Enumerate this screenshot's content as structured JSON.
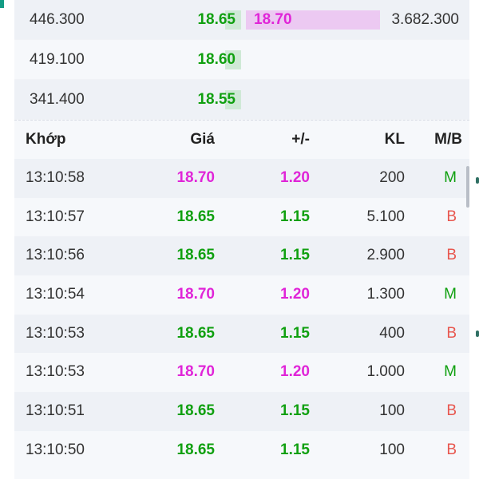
{
  "depth": [
    {
      "volume": "446.300",
      "bid_price": "18.65",
      "ask_price": "18.70",
      "ask_volume": "3.682.300"
    },
    {
      "volume": "419.100",
      "bid_price": "18.60",
      "ask_price": "",
      "ask_volume": ""
    },
    {
      "volume": "341.400",
      "bid_price": "18.55",
      "ask_price": "",
      "ask_volume": ""
    }
  ],
  "trades_header": {
    "time": "Khớp",
    "price": "Giá",
    "change": "+/-",
    "volume": "KL",
    "side": "M/B"
  },
  "trades": [
    {
      "time": "13:10:58",
      "price": "18.70",
      "change": "1.20",
      "volume": "200",
      "side": "M",
      "color": "#e025d8"
    },
    {
      "time": "13:10:57",
      "price": "18.65",
      "change": "1.15",
      "volume": "5.100",
      "side": "B",
      "color": "#10a010"
    },
    {
      "time": "13:10:56",
      "price": "18.65",
      "change": "1.15",
      "volume": "2.900",
      "side": "B",
      "color": "#10a010"
    },
    {
      "time": "13:10:54",
      "price": "18.70",
      "change": "1.20",
      "volume": "1.300",
      "side": "M",
      "color": "#e025d8"
    },
    {
      "time": "13:10:53",
      "price": "18.65",
      "change": "1.15",
      "volume": "400",
      "side": "B",
      "color": "#10a010"
    },
    {
      "time": "13:10:53",
      "price": "18.70",
      "change": "1.20",
      "volume": "1.000",
      "side": "M",
      "color": "#e025d8"
    },
    {
      "time": "13:10:51",
      "price": "18.65",
      "change": "1.15",
      "volume": "100",
      "side": "B",
      "color": "#10a010"
    },
    {
      "time": "13:10:50",
      "price": "18.65",
      "change": "1.15",
      "volume": "100",
      "side": "B",
      "color": "#10a010"
    }
  ],
  "colors": {
    "up_pink": "#e025d8",
    "ref_green": "#10a010",
    "sell_red": "#e8574f"
  }
}
